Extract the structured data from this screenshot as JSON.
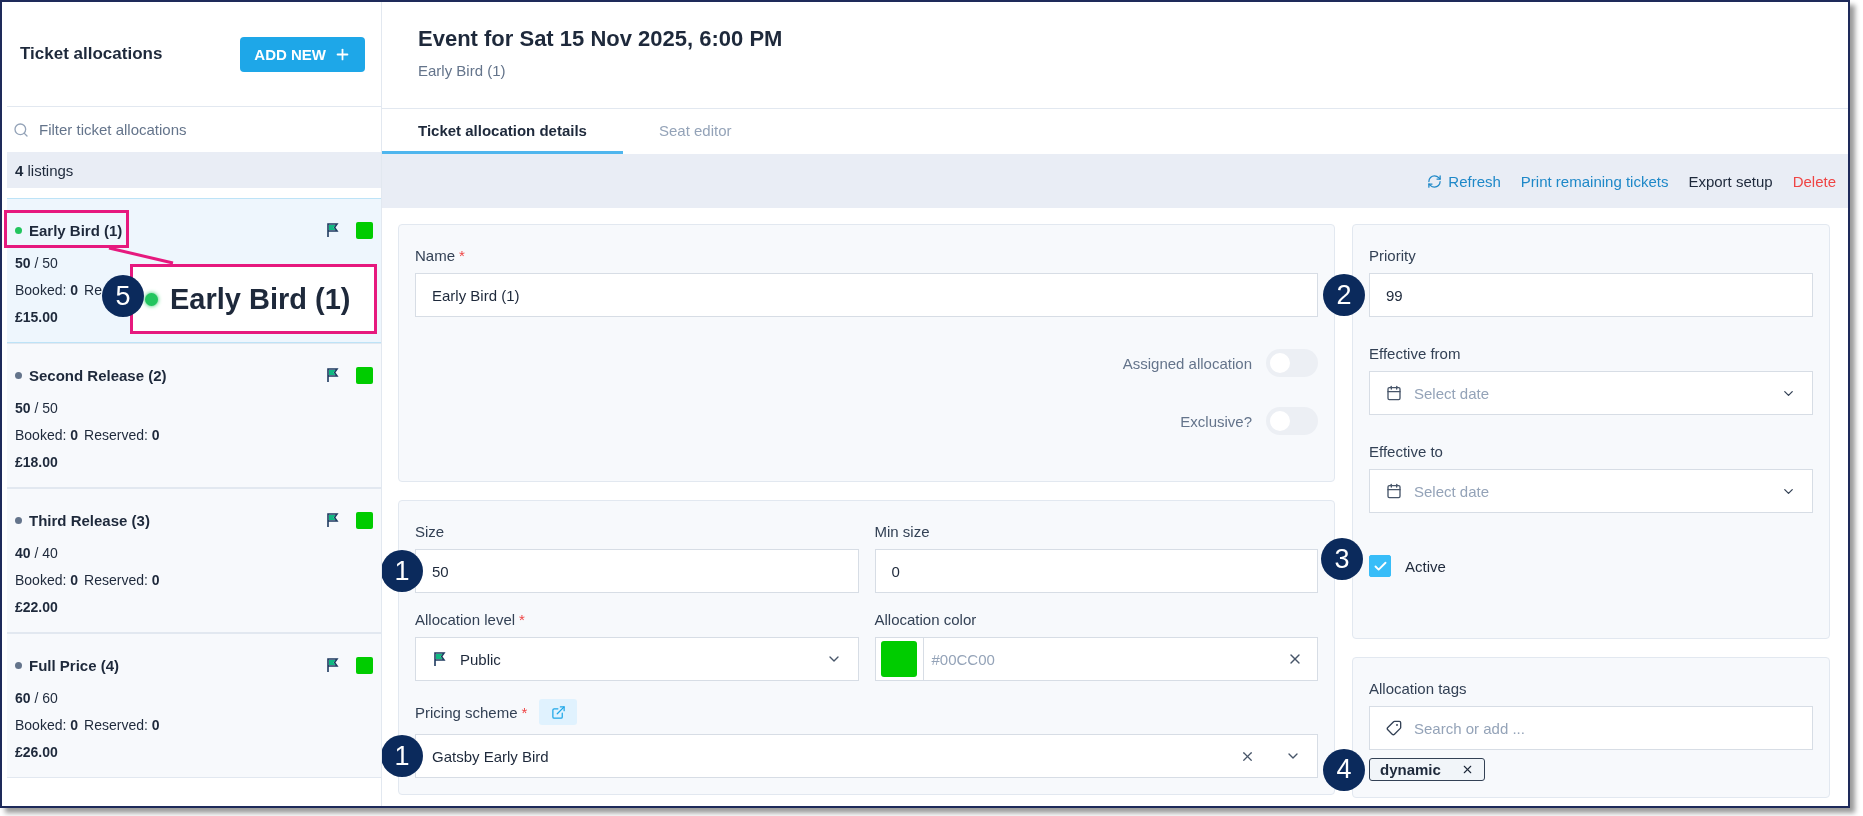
{
  "sidebar": {
    "title": "Ticket allocations",
    "add_button": "ADD NEW",
    "filter": {
      "placeholder": "Filter ticket allocations"
    },
    "listings": {
      "count": "4",
      "label": "listings"
    },
    "items": [
      {
        "name": "Early Bird (1)",
        "active": true,
        "selected": true,
        "capacity": "**50** / 50",
        "booked_label": "Booked:",
        "booked": "0",
        "reserved_label": "Re",
        "price": "£15.00",
        "color": "#00cc00",
        "callout": {
          "number": "5",
          "text": "Early Bird (1)"
        }
      },
      {
        "name": "Second Release (2)",
        "active": false,
        "selected": false,
        "capacity": "**50** / 50",
        "booked_label": "Booked:",
        "booked": "0",
        "reserved_label": "Reserved:",
        "reserved": "0",
        "price": "£18.00",
        "color": "#00cc00"
      },
      {
        "name": "Third Release (3)",
        "active": false,
        "selected": false,
        "capacity": "**40** / 40",
        "booked_label": "Booked:",
        "booked": "0",
        "reserved_label": "Reserved:",
        "reserved": "0",
        "price": "£22.00",
        "color": "#00cc00"
      },
      {
        "name": "Full Price (4)",
        "active": false,
        "selected": false,
        "capacity": "**60** / 60",
        "booked_label": "Booked:",
        "booked": "0",
        "reserved_label": "Reserved:",
        "reserved": "0",
        "price": "£26.00",
        "color": "#00cc00"
      }
    ]
  },
  "header": {
    "title": "Event for Sat 15 Nov 2025, 6:00 PM",
    "subtitle": "Early Bird (1)"
  },
  "tabs": [
    {
      "label": "Ticket allocation details",
      "selected": true
    },
    {
      "label": "Seat editor",
      "selected": false
    }
  ],
  "toolbar": [
    {
      "label": "Refresh",
      "kind": "refresh"
    },
    {
      "label": "Print remaining tickets",
      "kind": "link"
    },
    {
      "label": "Export setup",
      "kind": "plain"
    },
    {
      "label": "Delete",
      "kind": "danger"
    }
  ],
  "details": {
    "name": {
      "label": "Name",
      "required_mark": "*",
      "value": "Early Bird  (1)"
    },
    "toggles": [
      {
        "label": "Assigned allocation",
        "on": false
      },
      {
        "label": "Exclusive?",
        "on": false
      }
    ]
  },
  "capacity": {
    "size": {
      "label": "Size",
      "value": "50",
      "callout": "1"
    },
    "min_size": {
      "label": "Min size",
      "value": "0"
    },
    "allocation_level": {
      "label": "Allocation level",
      "required_mark": "*",
      "value": "Public"
    },
    "allocation_color": {
      "label": "Allocation color",
      "color": "#00cc00",
      "value": "#00CC00"
    },
    "pricing_scheme": {
      "label": "Pricing scheme",
      "required_mark": "*",
      "value": "Gatsby Early Bird",
      "callout": "1"
    }
  },
  "schedule": {
    "priority": {
      "label": "Priority",
      "value": "99",
      "callout": "2"
    },
    "effective_from": {
      "label": "Effective from",
      "placeholder": "Select date"
    },
    "effective_to": {
      "label": "Effective to",
      "placeholder": "Select date"
    },
    "active": {
      "label": "Active",
      "checked": true,
      "callout": "3"
    }
  },
  "tags": {
    "label": "Allocation tags",
    "placeholder": "Search or add ...",
    "items": [
      "dynamic"
    ],
    "callout": "4"
  }
}
